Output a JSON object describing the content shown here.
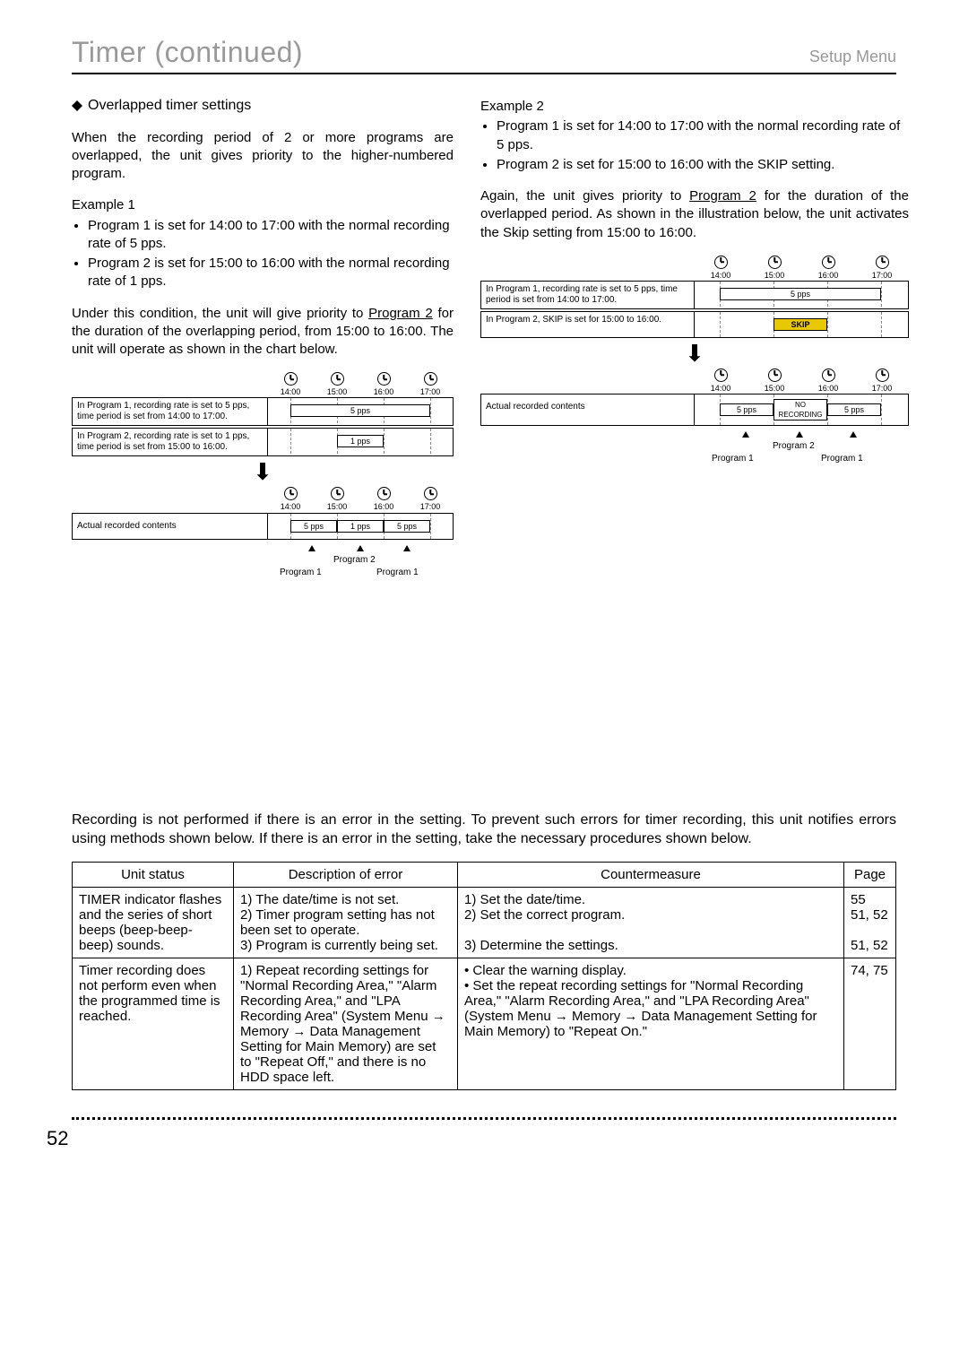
{
  "header": {
    "title": "Timer (continued)",
    "right": "Setup Menu"
  },
  "left": {
    "sectionHead": "Overlapped timer settings",
    "intro": "When the recording period of 2 or more programs are overlapped, the unit gives priority to the higher-numbered program.",
    "ex1Label": "Example 1",
    "ex1b1": "Program 1 is set for 14:00 to 17:00 with the normal recording rate of 5 pps.",
    "ex1b2": "Program 2 is set for 15:00 to 16:00 with the normal recording rate of 1 pps.",
    "ex1para": "Under this condition, the unit will give priority to Program 2 for the duration of the overlapping period, from 15:00 to 16:00. The unit will operate as shown in the chart below.",
    "diag1": {
      "times": [
        "14:00",
        "15:00",
        "16:00",
        "17:00"
      ],
      "row1Desc": "In Program 1, recording rate is set to 5 pps, time period is set from 14:00 to 17:00.",
      "row1Bar": "5 pps",
      "row2Desc": "In Program 2, recording rate is set to 1 pps, time period is set from 15:00 to 16:00.",
      "row2Bar": "1 pps",
      "actualDesc": "Actual recorded contents",
      "seg1": "5 pps",
      "seg2": "1 pps",
      "seg3": "5 pps",
      "lblP2": "Program 2",
      "lblP1a": "Program 1",
      "lblP1b": "Program 1"
    }
  },
  "right": {
    "ex2Label": "Example 2",
    "ex2b1": "Program 1 is set for 14:00 to 17:00 with the normal recording rate of 5 pps.",
    "ex2b2": "Program 2 is set for 15:00 to 16:00 with the SKIP setting.",
    "ex2para": "Again, the unit gives priority to Program 2 for the duration of the overlapped period. As shown in the illustration below, the unit activates the Skip setting from 15:00 to 16:00.",
    "diag2": {
      "times": [
        "14:00",
        "15:00",
        "16:00",
        "17:00"
      ],
      "row1Desc": "In Program 1, recording rate is set to 5 pps, time period is set from 14:00 to 17:00.",
      "row1Bar": "5 pps",
      "row2Desc": "In Program 2, SKIP is set for 15:00 to 16:00.",
      "row2Bar": "SKIP",
      "actualDesc": "Actual recorded contents",
      "seg1": "5 pps",
      "seg2a": "NO",
      "seg2b": "RECORDING",
      "seg3": "5 pps",
      "lblP2": "Program 2",
      "lblP1a": "Program 1",
      "lblP1b": "Program 1"
    }
  },
  "errorIntro": "Recording is not performed if there is an error in the setting. To prevent such errors for timer recording, this unit notifies errors using methods shown below. If there is an error in the setting, take the necessary procedures shown below.",
  "table": {
    "h1": "Unit status",
    "h2": "Description of error",
    "h3": "Countermeasure",
    "h4": "Page",
    "r1c1": "TIMER indicator flashes and the series of short beeps (beep-beep-beep) sounds.",
    "r1c2": "1) The date/time is not set.\n2) Timer program setting has not been set to operate.\n3) Program is currently being set.",
    "r1c3": "1) Set the date/time.\n2) Set the correct program.\n\n3) Determine the settings.",
    "r1c4": "55\n51, 52\n\n51, 52",
    "r2c1": "Timer recording does not perform even when the programmed time is reached.",
    "r2c2": "1) Repeat recording settings for \"Normal Recording Area,\" \"Alarm Recording Area,\" and \"LPA Recording Area\" (System Menu → Memory → Data Management Setting for Main Memory) are set to \"Repeat Off,\" and there is no HDD space left.",
    "r2c3": "• Clear the warning display.\n• Set the repeat recording settings for \"Normal Recording Area,\" \"Alarm Recording Area,\" and \"LPA Recording Area\" (System Menu → Memory → Data Management Setting for Main Memory) to \"Repeat On.\"",
    "r2c4": "74, 75"
  },
  "pageNumber": "52"
}
